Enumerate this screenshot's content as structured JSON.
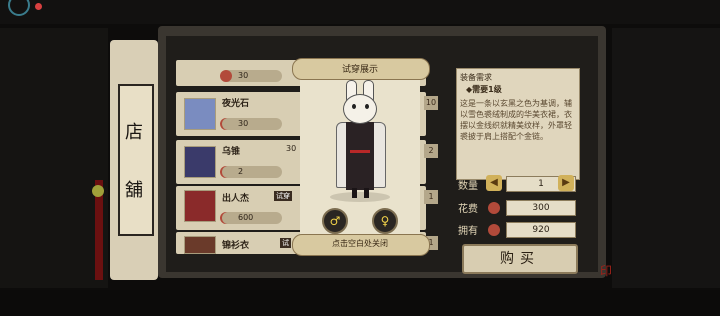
{
  "shop": {
    "side_title_1": "店",
    "side_title_2": "舖",
    "items": [
      {
        "name": "",
        "price": "30",
        "count": ""
      },
      {
        "name": "夜光石",
        "price": "30",
        "count": "10"
      },
      {
        "name": "乌锥",
        "price": "30",
        "count": "2",
        "qty": "2"
      },
      {
        "name": "出人杰",
        "badge": "试穿",
        "price": "600",
        "count": "1"
      },
      {
        "name": "锦衫衣",
        "badge": "试",
        "price": "",
        "count": "1"
      }
    ]
  },
  "detail": {
    "title": "装备需求",
    "need": "◆需要1级",
    "desc": "这是一条以玄黑之色为基调，辅以雪色裘绒制成的华美衣裙，衣摆以金线织就精美纹样，外罩轻裘披于肩上搭配个金链。"
  },
  "purchase": {
    "qty_label": "数量",
    "qty_value": "1",
    "cost_label": "花费",
    "cost_value": "300",
    "owned_label": "拥有",
    "owned_value": "920",
    "buy_label": "购买"
  },
  "popup": {
    "title": "试穿展示",
    "hint": "点击空白处关闭",
    "male_symbol": "♂",
    "female_symbol": "♀"
  },
  "colors": {
    "accent_red": "#b82828",
    "gold": "#f2d34a",
    "parchment": "#d8ceb3"
  }
}
